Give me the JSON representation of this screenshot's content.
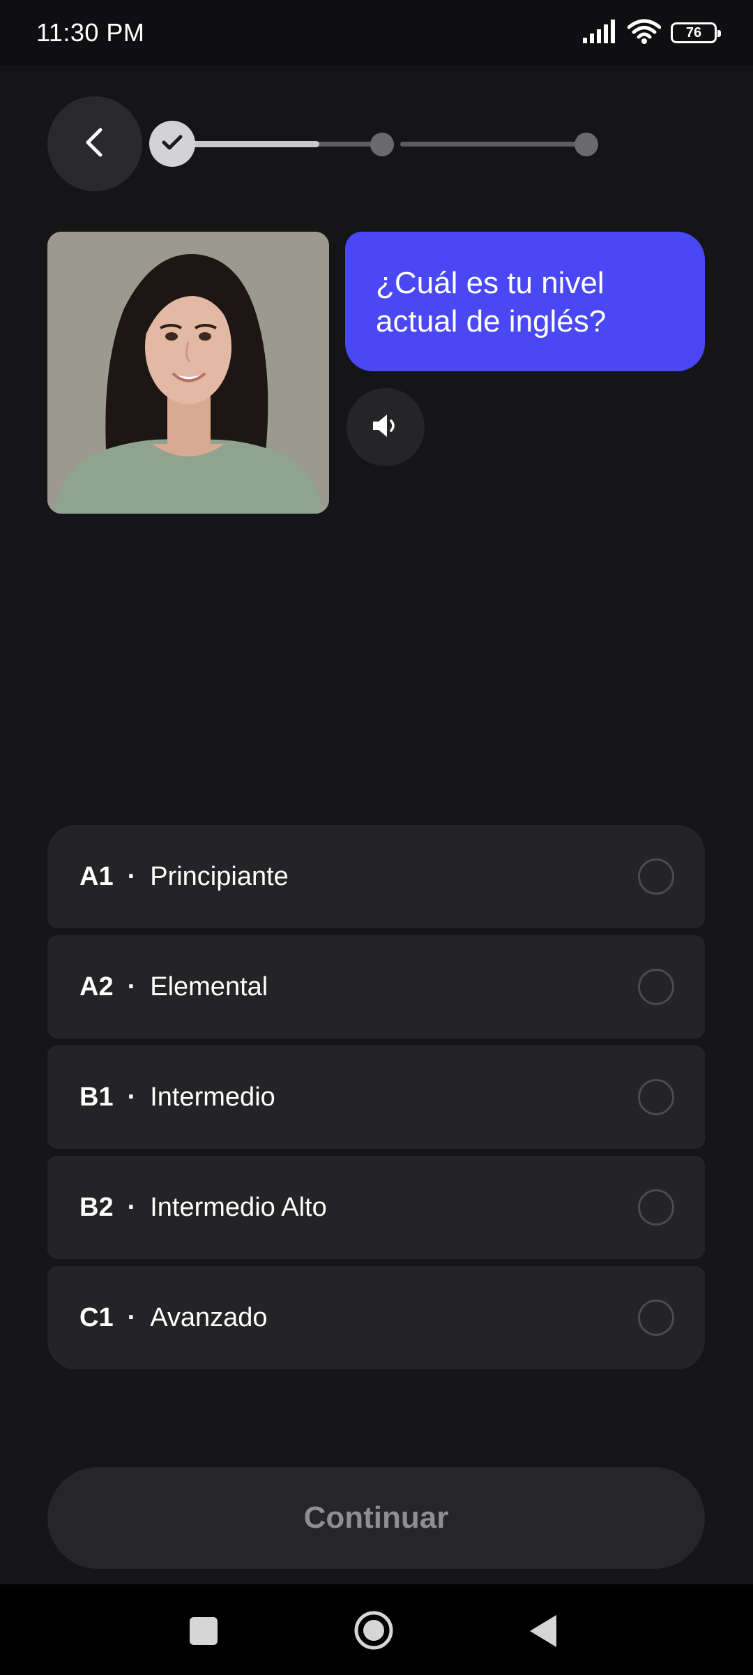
{
  "status_bar": {
    "time": "11:30 PM",
    "battery": "76",
    "icons": [
      "signal-icon",
      "wifi-icon",
      "battery-icon"
    ]
  },
  "header": {
    "back_icon": "chevron-left-icon",
    "progress": {
      "steps": 3,
      "completed": 1,
      "current_step_fraction": 0.6
    }
  },
  "question": {
    "text": "¿Cuál es tu nivel actual de inglés?",
    "audio_icon": "speaker-icon",
    "bubble_color": "#4a48f5"
  },
  "options": [
    {
      "code": "A1",
      "separator": "·",
      "label": "Principiante",
      "selected": false
    },
    {
      "code": "A2",
      "separator": "·",
      "label": "Elemental",
      "selected": false
    },
    {
      "code": "B1",
      "separator": "·",
      "label": "Intermedio",
      "selected": false
    },
    {
      "code": "B2",
      "separator": "·",
      "label": "Intermedio Alto",
      "selected": false
    },
    {
      "code": "C1",
      "separator": "·",
      "label": "Avanzado",
      "selected": false
    }
  ],
  "footer": {
    "continue_label": "Continuar",
    "enabled": false
  },
  "nav_bar": {
    "icons": [
      "recents-square-icon",
      "home-circle-icon",
      "back-triangle-icon"
    ]
  }
}
